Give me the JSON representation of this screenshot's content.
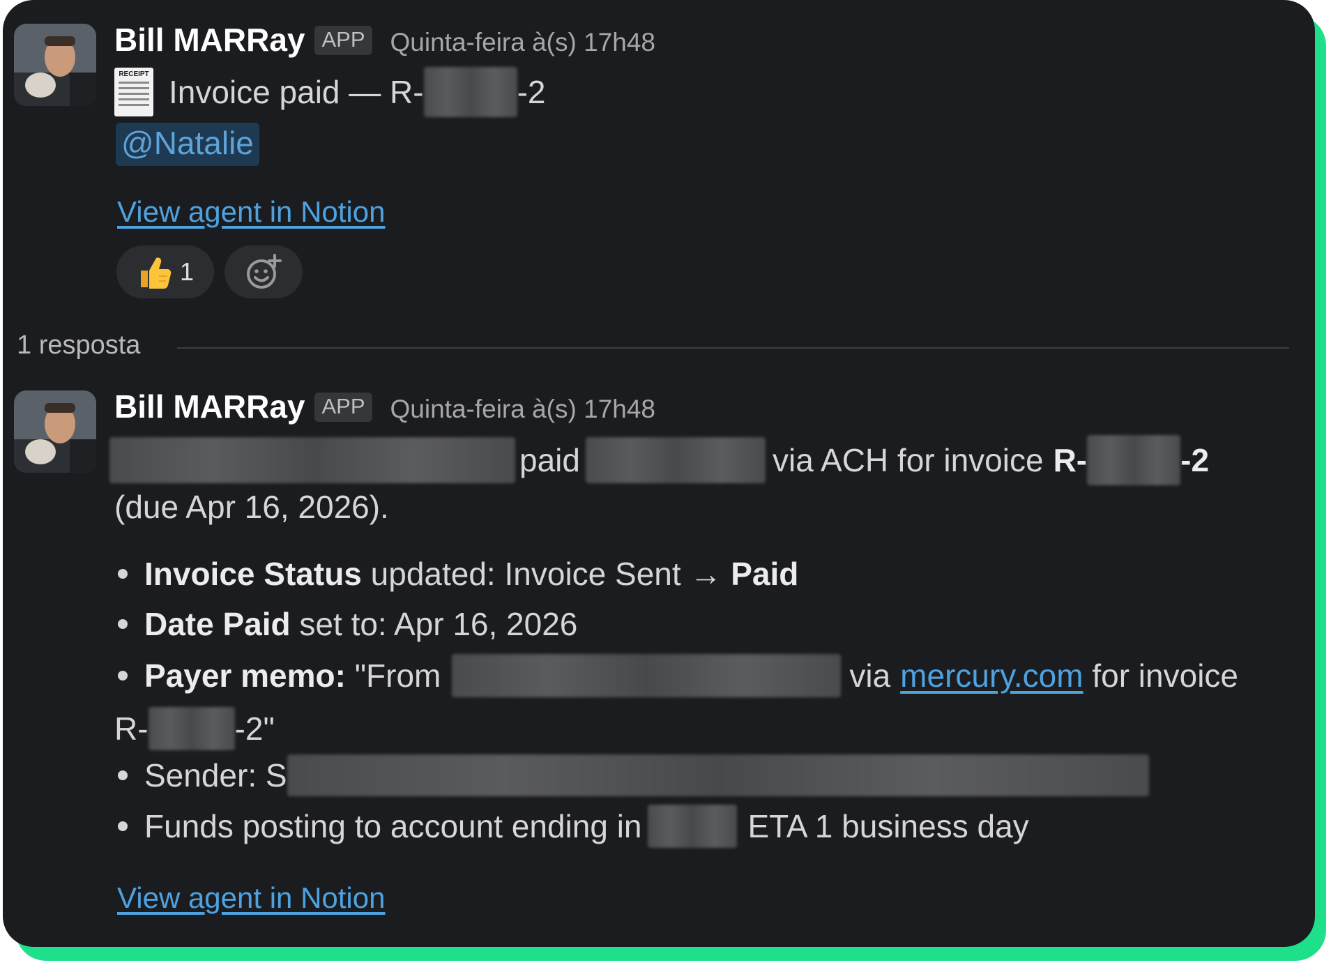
{
  "message1": {
    "author": "Bill MARRay",
    "badge": "APP",
    "timestamp": "Quinta-feira à(s) 17h48",
    "receipt_icon_text": "RECEIPT",
    "title_prefix": "Invoice paid — R-",
    "title_suffix": "-2",
    "mention": "@Natalie",
    "link": "View agent in Notion",
    "reactions": [
      {
        "emoji": "👍",
        "icon": "thumbs-up-icon",
        "count": "1"
      },
      {
        "icon": "add-reaction-icon"
      }
    ]
  },
  "thread": {
    "reply_count_label": "1 resposta"
  },
  "message2": {
    "author": "Bill MARRay",
    "badge": "APP",
    "timestamp": "Quinta-feira à(s) 17h48",
    "line1": {
      "paid": "paid",
      "via_ach": "via ACH for invoice",
      "invoice_prefix": "R-",
      "invoice_suffix": "-2"
    },
    "line2": "(due Apr 16, 2026).",
    "bullets": {
      "status_label": "Invoice Status",
      "status_text": " updated: Invoice Sent → ",
      "status_value": "Paid",
      "date_label": "Date Paid",
      "date_text": " set to: Apr 16, 2026",
      "memo_label": "Payer memo:",
      "memo_from": " \"From",
      "memo_via": "via",
      "memo_link": "mercury.com",
      "memo_for": " for invoice",
      "memo_cont_prefix": "R-",
      "memo_cont_suffix": "-2\"",
      "sender_label": "Sender: S",
      "funds_text": "Funds posting to account ending in",
      "funds_eta": "ETA 1 business day"
    },
    "link": "View agent in Notion"
  },
  "colors": {
    "panel_bg": "#1b1c1f",
    "accent_green": "#1fe08a",
    "link": "#4ea2e0",
    "mention_bg": "#1e3a52"
  }
}
